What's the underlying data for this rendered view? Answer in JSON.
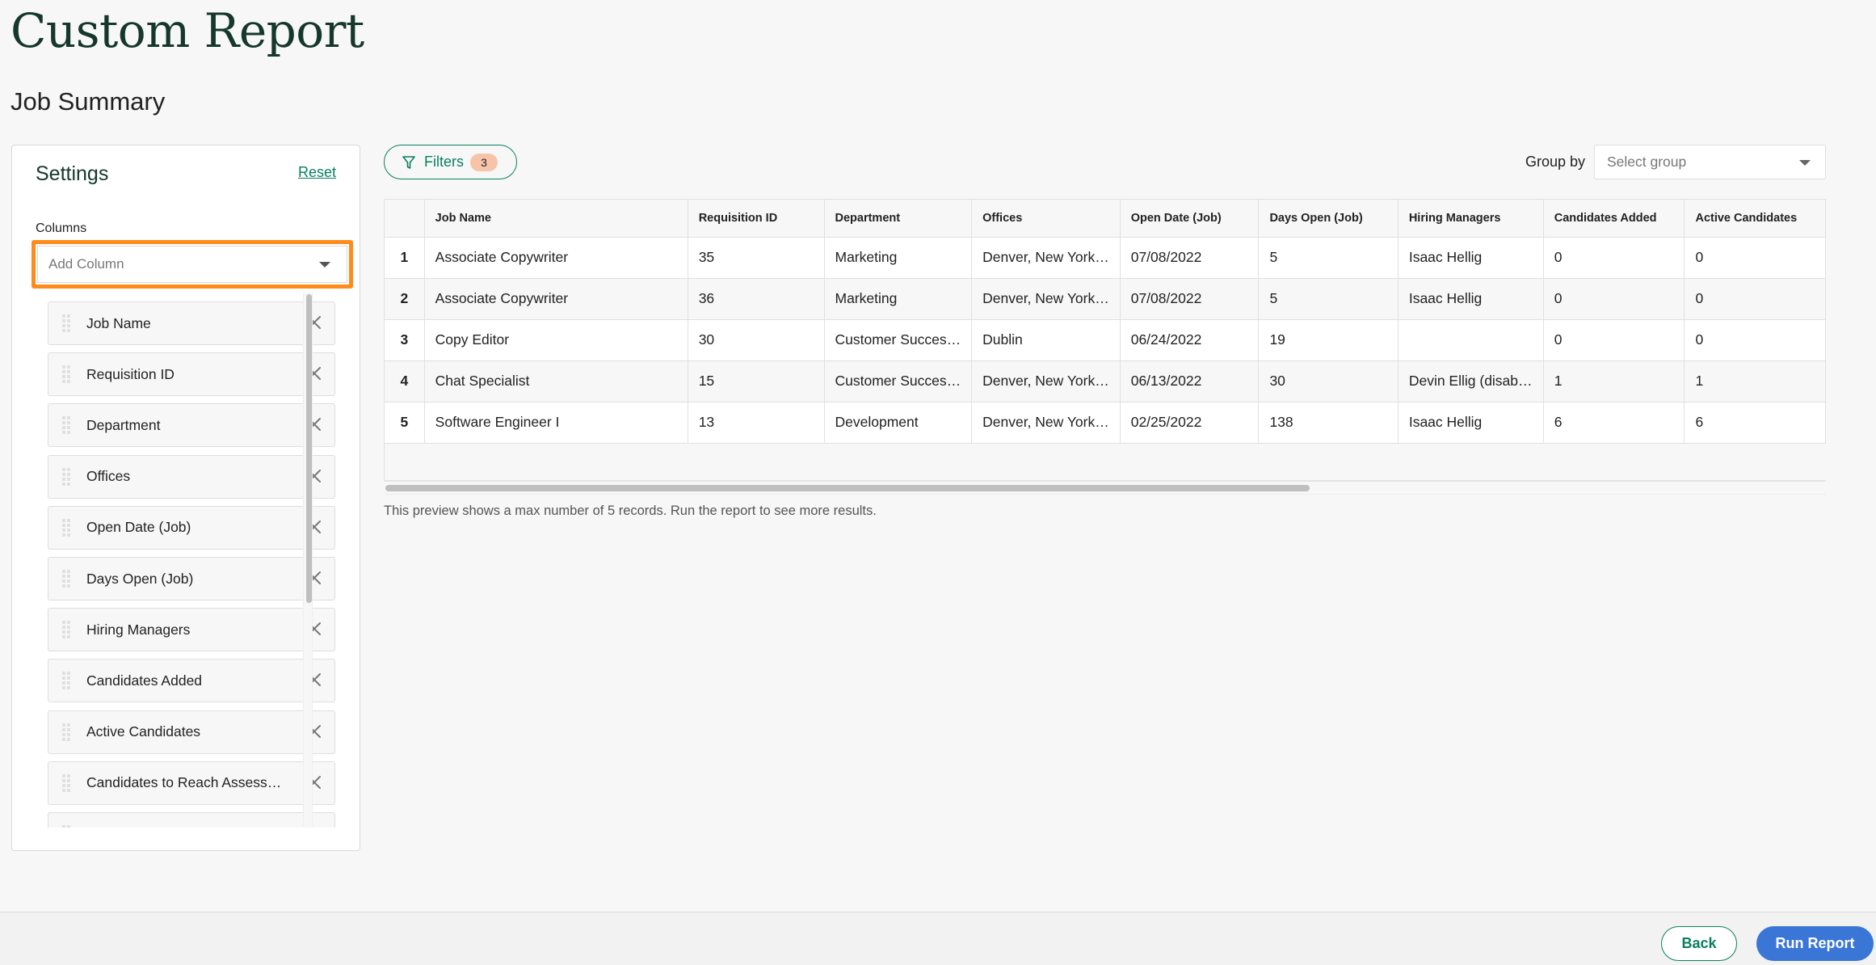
{
  "page": {
    "title": "Custom Report",
    "subtitle": "Job Summary"
  },
  "settings": {
    "title": "Settings",
    "reset_label": "Reset",
    "columns_label": "Columns",
    "add_column_placeholder": "Add Column",
    "columns": [
      {
        "label": "Job Name"
      },
      {
        "label": "Requisition ID"
      },
      {
        "label": "Department"
      },
      {
        "label": "Offices"
      },
      {
        "label": "Open Date (Job)"
      },
      {
        "label": "Days Open (Job)"
      },
      {
        "label": "Hiring Managers"
      },
      {
        "label": "Candidates Added"
      },
      {
        "label": "Active Candidates"
      },
      {
        "label": "Candidates to Reach Assess…"
      },
      {
        "label": ""
      }
    ]
  },
  "toolbar": {
    "filters_label": "Filters",
    "filters_count": "3",
    "group_by_label": "Group by",
    "group_select_placeholder": "Select group"
  },
  "table": {
    "headers": [
      "",
      "Job Name",
      "Requisition ID",
      "Department",
      "Offices",
      "Open Date (Job)",
      "Days Open (Job)",
      "Hiring Managers",
      "Candidates Added",
      "Active Candidates"
    ],
    "rows": [
      [
        "1",
        "Associate Copywriter",
        "35",
        "Marketing",
        "Denver, New York…",
        "07/08/2022",
        "5",
        "Isaac Hellig",
        "0",
        "0"
      ],
      [
        "2",
        "Associate Copywriter",
        "36",
        "Marketing",
        "Denver, New York…",
        "07/08/2022",
        "5",
        "Isaac Hellig",
        "0",
        "0"
      ],
      [
        "3",
        "Copy Editor",
        "30",
        "Customer Succes…",
        "Dublin",
        "06/24/2022",
        "19",
        "",
        "0",
        "0"
      ],
      [
        "4",
        "Chat Specialist",
        "15",
        "Customer Succes…",
        "Denver, New York…",
        "06/13/2022",
        "30",
        "Devin Ellig (disab…",
        "1",
        "1"
      ],
      [
        "5",
        "Software Engineer I",
        "13",
        "Development",
        "Denver, New York…",
        "02/25/2022",
        "138",
        "Isaac Hellig",
        "6",
        "6"
      ]
    ],
    "preview_note": "This preview shows a max number of 5 records. Run the report to see more results."
  },
  "footer": {
    "back_label": "Back",
    "run_label": "Run Report"
  },
  "colors": {
    "brand_green": "#0a7f5f",
    "title_green": "#15372c",
    "highlight_orange": "#ff8c1a",
    "badge_peach": "#f5c4a9",
    "primary_blue": "#3a76d6"
  },
  "icons": {
    "filter": "funnel-icon",
    "drag": "drag-handle-icon",
    "remove": "close-icon",
    "dropdown": "chevron-down-icon"
  }
}
